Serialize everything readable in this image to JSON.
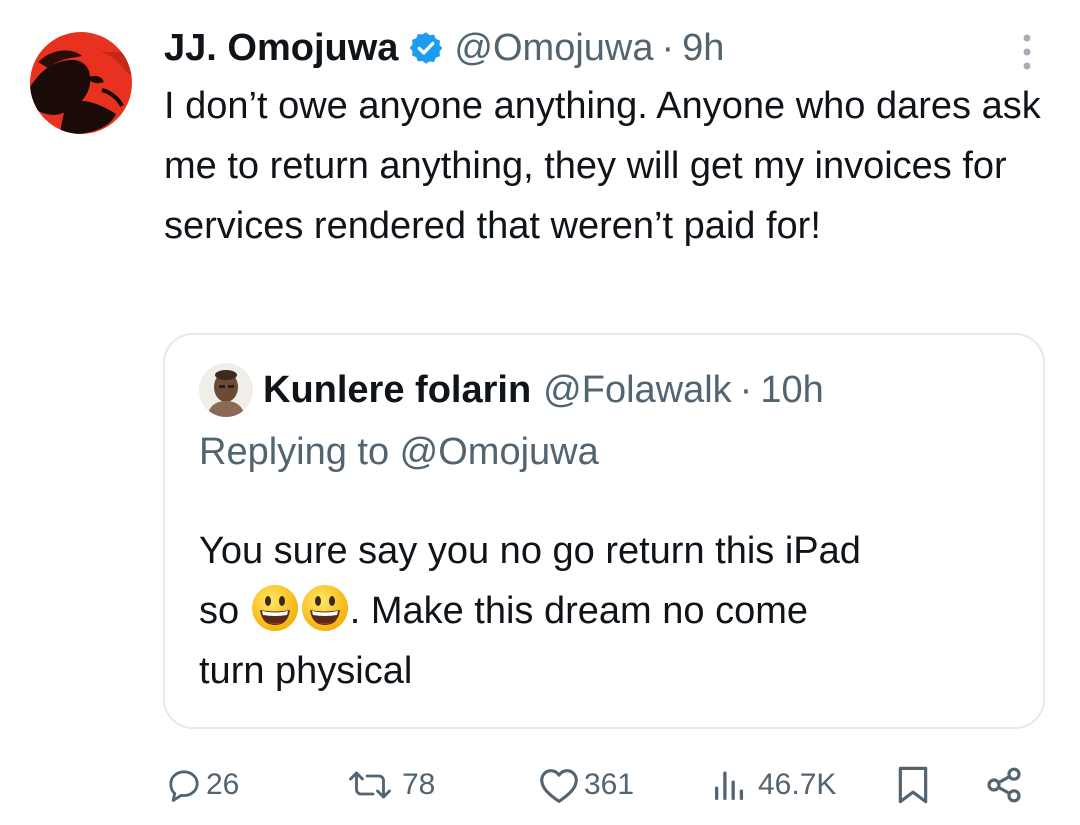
{
  "tweet": {
    "author_name": "JJ. Omojuwa",
    "handle": "@Omojuwa",
    "separator": "·",
    "time": "9h",
    "text": "I don’t owe anyone anything. Anyone who dares ask me to return anything, they will get my invoices for services rendered that weren’t paid for!"
  },
  "quote": {
    "author_name": "Kunlere folarin",
    "handle": "@Folawalk",
    "separator": "·",
    "time": "10h",
    "replying_to": "Replying to @Omojuwa",
    "text_line1": "You sure say you no go return this iPad",
    "text_so": "so",
    "text_after_emoji": ". Make this dream no come",
    "text_line3": "turn physical",
    "emoji_count": 2
  },
  "actions": {
    "replies": "26",
    "retweets": "78",
    "likes": "361",
    "views": "46.7K"
  },
  "icons": {
    "verified": "verified-badge-icon",
    "more": "more-vertical-icon",
    "reply": "reply-icon",
    "retweet": "retweet-icon",
    "like": "heart-icon",
    "views": "views-chart-icon",
    "bookmark": "bookmark-icon",
    "share": "share-icon"
  },
  "colors": {
    "text": "#0f1419",
    "muted": "#536471",
    "verified_blue": "#1d9bf0",
    "avatar_red": "#e8321f",
    "border": "#e6e9ec"
  }
}
